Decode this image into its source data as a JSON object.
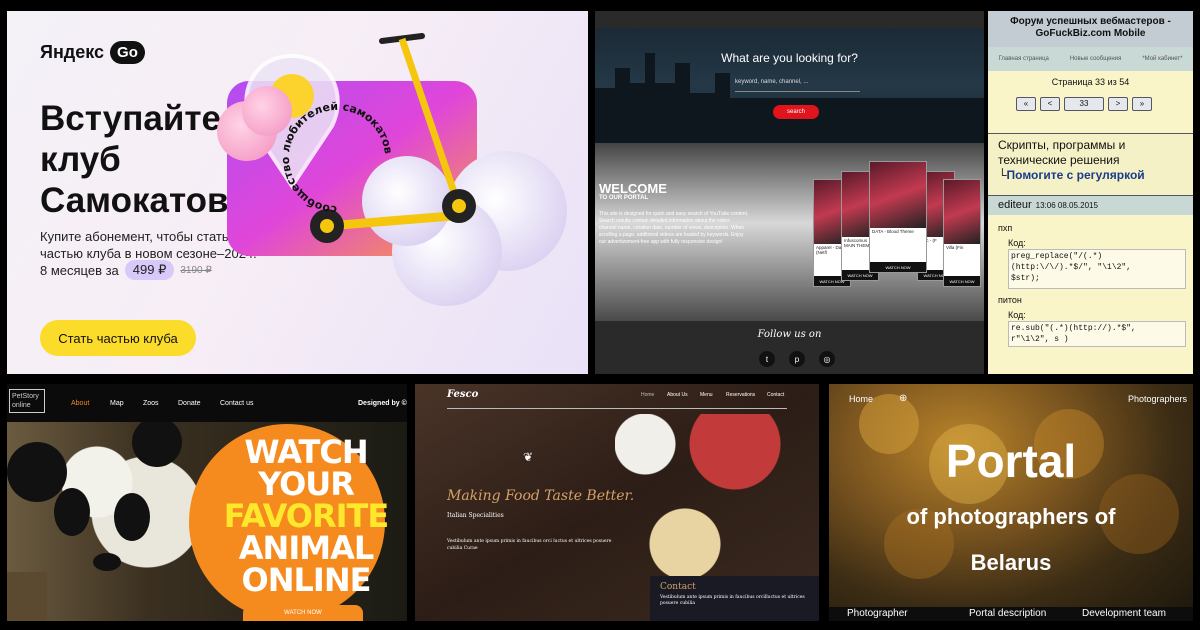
{
  "p1": {
    "logo_text": "Яндекс",
    "logo_go": "Go",
    "headline": "Вступайте в клуб Самокатов",
    "body": "Купите абонемент, чтобы стать частью клуба в новом сезоне–2024.",
    "price_prefix": "8 месяцев за",
    "price": "499 ₽",
    "price_old": "3190 ₽",
    "cta": "Стать частью клуба",
    "ring_text": "сообщество любителей самокатов",
    "colors": {
      "cta_bg": "#fcdc2a",
      "badge_bg": "#d9c9fb"
    }
  },
  "p2": {
    "hero_title": "What are you looking for?",
    "search_placeholder": "keyword, name, channel, ...",
    "search_button": "search",
    "welcome": "WELCOME",
    "welcome_sub": "TO OUR PORTAL",
    "welcome_text": "This site is designed for quick and easy search of YouTube content. Search results contain detailed information about the video: channel name, creation date, number of views, description. When scrolling a page, additional videos are loaded by keywords. Enjoy our advertizement-free app with fully responsive design!",
    "cards": [
      {
        "caption": "Apparel - Dark (Netfl",
        "watch": "WATCH NOW"
      },
      {
        "caption": "Infuscomus MAIN THEM",
        "watch": "WATCH NOW"
      },
      {
        "caption": "DATA - Blood Theme",
        "watch": "WATCH NOW"
      },
      {
        "caption": "cerc - (F",
        "watch": "WATCH NOW"
      },
      {
        "caption": "Villa (Fin",
        "watch": "WATCH NOW"
      }
    ],
    "follow": "Follow us on",
    "social": [
      "twitter-icon",
      "pinterest-icon",
      "dribbble-icon"
    ],
    "colors": {
      "search_button": "#e0141c"
    }
  },
  "p3": {
    "title_line1": "Форум успешных вебмастеров -",
    "title_line2": "GoFuckBiz.com Mobile",
    "tabs": [
      "Главная страница",
      "Новые сообщения",
      "*Мой кабинет*"
    ],
    "page_info": "Страница 33 из 54",
    "pager": [
      "«",
      "<",
      "33",
      ">",
      "»"
    ],
    "topic_text": "Скрипты, программы и технические решения",
    "topic_link": "Помогите с регуляркой",
    "user": "editeur",
    "date": "13:06 08.05.2015",
    "lang1": "пхп",
    "code_label": "Код:",
    "code1": "preg_replace(\"/(.*)\n(http:\\/\\/).*$/\", \"\\1\\2\",\n$str);",
    "lang2": "питон",
    "code2": "re.sub(\"(.*)(http://).*$\",\nr\"\\1\\2\", s )"
  },
  "p4": {
    "brand": "PetStory online",
    "nav": [
      "About",
      "Map",
      "Zoos",
      "Donate",
      "Contact us"
    ],
    "designed_by": "Designed by ©",
    "headline_1": "WATCH",
    "headline_2": "YOUR",
    "headline_3": "FAVORITE",
    "headline_4": "ANIMAL",
    "headline_5": "ONLINE",
    "watch_button": "WATCH NOW",
    "colors": {
      "accent": "#f58a1f",
      "highlight": "#fde82c"
    }
  },
  "p5": {
    "brand": "Fesco",
    "menu": [
      "Home",
      "About Us",
      "Menu",
      "Reservations",
      "Contact"
    ],
    "tagline": "Making Food Taste Better.",
    "sub": "Italian Specialities",
    "desc": "Vestibulum ante ipsum primis in faucibus orci luctus et ultrices posuere cubilia Curae",
    "contact_title": "Contact",
    "contact_text": "Vestibulum ante ipsum primis in faucibus orcilluctus et ultrices posuere cubilia",
    "colors": {
      "accent": "#d2a267"
    }
  },
  "p6": {
    "home": "Home",
    "photographers": "Photographers",
    "title": "Portal",
    "sub1": "of photographers of",
    "sub2": "Belarus",
    "footer": [
      "Photographer",
      "Portal description",
      "Development team"
    ]
  }
}
